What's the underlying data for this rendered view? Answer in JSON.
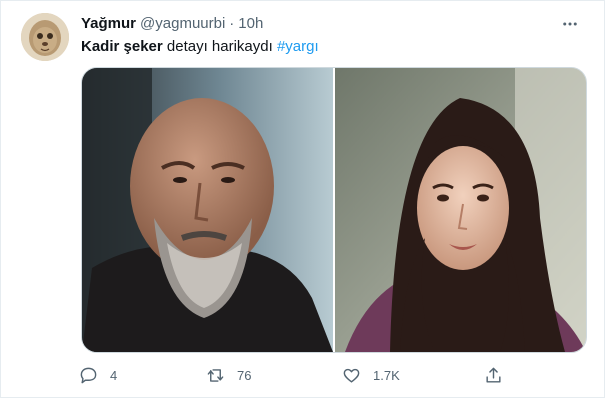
{
  "tweet": {
    "display_name": "Yağmur",
    "handle": "@yagmuurbi",
    "separator": "·",
    "time": "10h",
    "text_bold": "Kadir şeker",
    "text_plain": " detayı harikaydı ",
    "hashtag": "#yargı"
  },
  "actions": {
    "reply_count": "4",
    "retweet_count": "76",
    "like_count": "1.7K"
  },
  "colors": {
    "accent": "#1d9bf0",
    "text": "#0f1419",
    "secondary": "#536471"
  },
  "icons": {
    "more": "more-horizontal-icon",
    "reply": "reply-icon",
    "retweet": "retweet-icon",
    "like": "heart-icon",
    "share": "share-icon"
  }
}
